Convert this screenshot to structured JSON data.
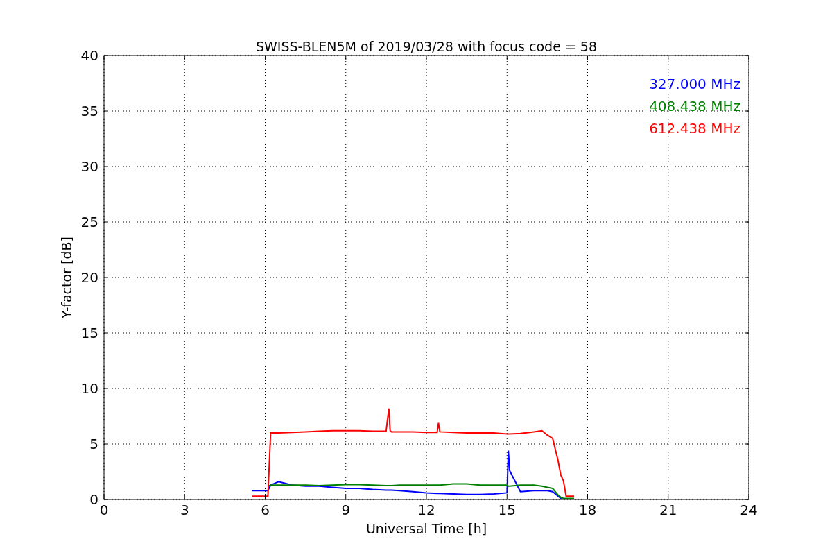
{
  "chart": {
    "chart_data": {
      "type": "line",
      "title": "SWISS-BLEN5M of 2019/03/28 with focus code = 58",
      "xlabel": "Universal Time [h]",
      "ylabel": "Y-factor [dB]",
      "x": [
        5.5,
        6.0,
        6.1,
        6.2,
        6.5,
        7,
        7.5,
        8,
        8.5,
        9,
        9.5,
        10,
        10.5,
        10.6,
        10.65,
        10.7,
        11,
        11.5,
        12,
        12.4,
        12.45,
        12.5,
        13,
        13.5,
        14,
        14.5,
        15,
        15.05,
        15.1,
        15.5,
        16,
        16.3,
        16.5,
        16.7,
        16.8,
        16.9,
        17.0,
        17.1,
        17.2,
        17.5
      ],
      "series": [
        {
          "name": "327.000 MHz",
          "color": "#0000ff",
          "values": [
            0.8,
            0.8,
            0.8,
            1.3,
            1.6,
            1.3,
            1.2,
            1.2,
            1.1,
            1.0,
            1.0,
            0.9,
            0.85,
            0.85,
            0.85,
            0.85,
            0.8,
            0.7,
            0.6,
            0.55,
            0.55,
            0.55,
            0.5,
            0.45,
            0.45,
            0.5,
            0.6,
            4.4,
            2.6,
            0.7,
            0.8,
            0.8,
            0.8,
            0.7,
            0.5,
            0.3,
            0.1,
            0.1,
            null,
            null
          ]
        },
        {
          "name": "408.438 MHz",
          "color": "#008000",
          "values": [
            null,
            null,
            1.2,
            1.3,
            1.3,
            1.3,
            1.3,
            1.25,
            1.3,
            1.35,
            1.35,
            1.3,
            1.25,
            1.25,
            1.25,
            1.25,
            1.3,
            1.3,
            1.3,
            1.3,
            1.3,
            1.3,
            1.4,
            1.4,
            1.3,
            1.3,
            1.3,
            1.2,
            1.2,
            1.3,
            1.3,
            1.2,
            1.1,
            1.0,
            0.7,
            0.4,
            0.2,
            0.1,
            0.1,
            0.1
          ]
        },
        {
          "name": "612.438 MHz",
          "color": "#ff0000",
          "values": [
            0.3,
            0.3,
            0.3,
            6.0,
            6.0,
            6.05,
            6.1,
            6.15,
            6.2,
            6.2,
            6.2,
            6.15,
            6.15,
            8.2,
            6.2,
            6.1,
            6.1,
            6.1,
            6.05,
            6.05,
            6.9,
            6.1,
            6.05,
            6.0,
            6.0,
            6.0,
            5.9,
            5.9,
            5.9,
            5.95,
            6.1,
            6.2,
            5.8,
            5.5,
            4.5,
            3.5,
            2.2,
            1.7,
            0.3,
            0.3
          ]
        }
      ],
      "xlim": [
        0,
        24
      ],
      "ylim": [
        0,
        40
      ],
      "xticks": [
        0,
        3,
        6,
        9,
        12,
        15,
        18,
        21,
        24
      ],
      "yticks": [
        0,
        5,
        10,
        15,
        20,
        25,
        30,
        35,
        40
      ],
      "grid": true
    }
  }
}
